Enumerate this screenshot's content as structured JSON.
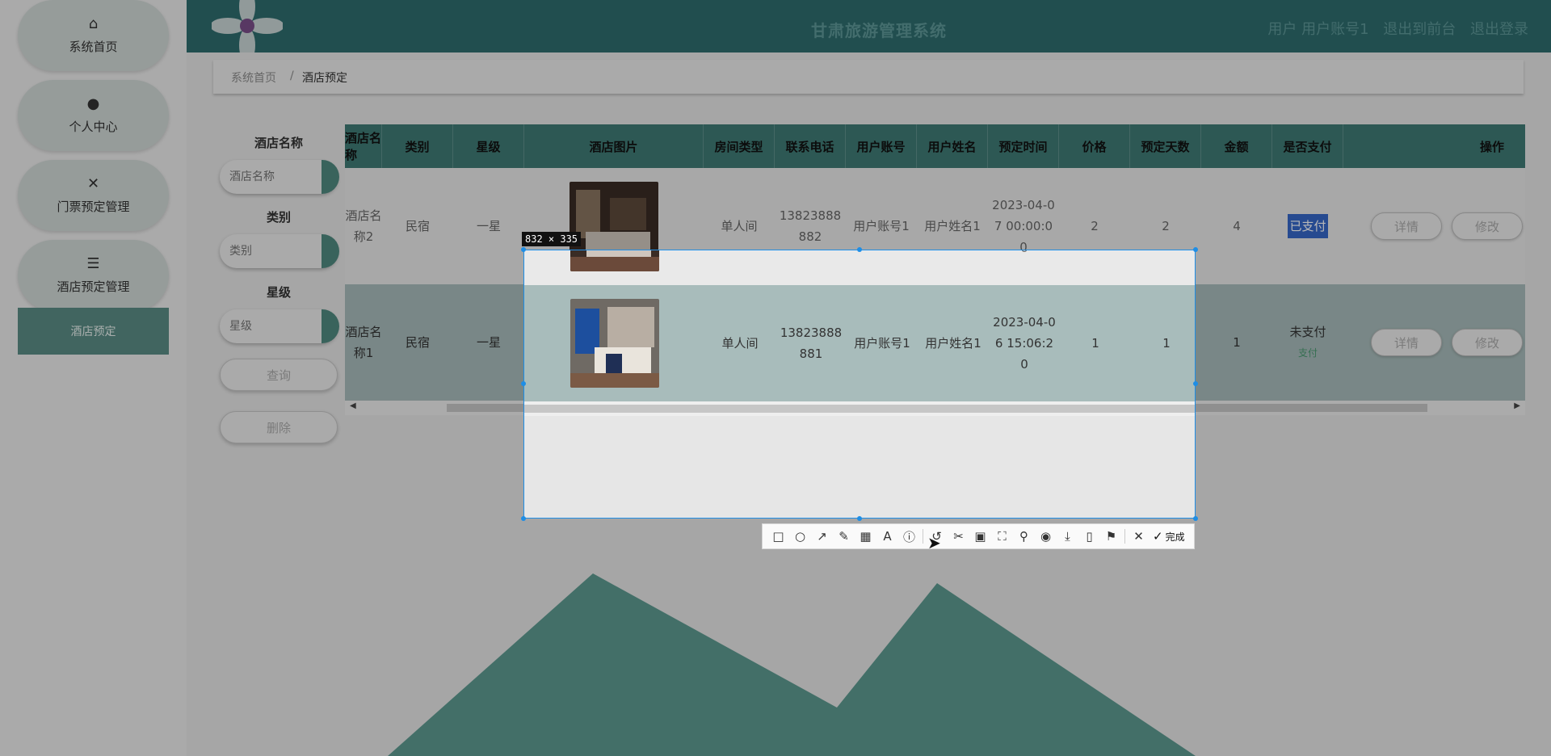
{
  "sidebar": {
    "items": [
      {
        "label": "系统首页",
        "icon": "home-icon"
      },
      {
        "label": "个人中心",
        "icon": "user-icon"
      },
      {
        "label": "门票预定管理",
        "icon": "ticket-icon"
      },
      {
        "label": "酒店预定管理",
        "icon": "sliders-icon"
      }
    ],
    "sub_item": "酒店预定"
  },
  "header": {
    "title": "甘肃旅游管理系统",
    "user_text": "用户 用户账号1",
    "backend_link": "退出到前台",
    "logout_link": "退出登录"
  },
  "breadcrumb": {
    "home": "系统首页",
    "current": "酒店预定"
  },
  "filters": {
    "hotel_name_label": "酒店名称",
    "hotel_name_placeholder": "酒店名称",
    "category_label": "类别",
    "category_placeholder": "类别",
    "star_label": "星级",
    "star_placeholder": "星级",
    "query_button": "查询",
    "delete_button": "删除"
  },
  "table": {
    "headers": [
      "酒店名称",
      "类别",
      "星级",
      "酒店图片",
      "房间类型",
      "联系电话",
      "用户账号",
      "用户姓名",
      "预定时间",
      "价格",
      "预定天数",
      "金额",
      "是否支付",
      "操作"
    ],
    "rows": [
      {
        "name": "酒店名称2",
        "category": "民宿",
        "star": "一星",
        "room": "单人间",
        "phone": "13823888882",
        "account": "用户账号1",
        "username": "用户姓名1",
        "time": "2023-04-07 00:00:00",
        "price": "2",
        "days": "2",
        "amount": "4",
        "paid": "已支付",
        "pay_link": ""
      },
      {
        "name": "酒店名称1",
        "category": "民宿",
        "star": "一星",
        "room": "单人间",
        "phone": "13823888881",
        "account": "用户账号1",
        "username": "用户姓名1",
        "time": "2023-04-06 15:06:20",
        "price": "1",
        "days": "1",
        "amount": "1",
        "paid": "未支付",
        "pay_link": "支付"
      }
    ],
    "detail_button": "详情",
    "edit_button": "修改"
  },
  "capture": {
    "size_label": "832 × 335",
    "done_label": "完成",
    "tools": [
      "rect-icon",
      "circle-icon",
      "arrow-icon",
      "pen-icon",
      "mosaic-icon",
      "text-icon",
      "number-icon",
      "undo-icon",
      "cut-icon",
      "ocr-icon",
      "scroll-capture-icon",
      "pin-icon",
      "record-icon",
      "download-icon",
      "device-icon",
      "bookmark-icon",
      "close-icon"
    ]
  }
}
